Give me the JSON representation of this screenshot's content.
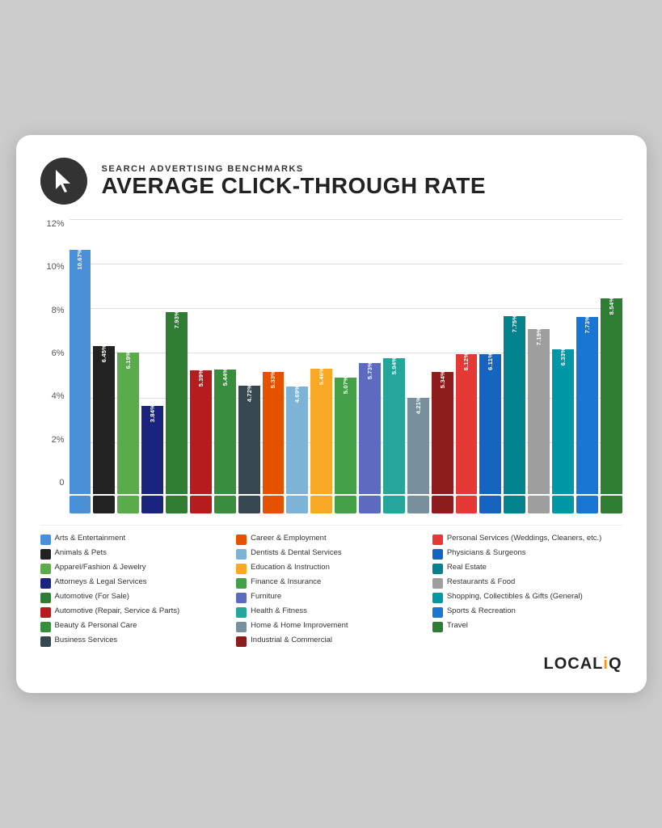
{
  "header": {
    "subtitle": "Search Advertising Benchmarks",
    "title": "Average Click-Through Rate",
    "icon_label": "cursor-icon"
  },
  "chart": {
    "y_labels": [
      "12%",
      "10%",
      "8%",
      "6%",
      "4%",
      "2%",
      "0"
    ],
    "max_value": 12,
    "bars": [
      {
        "label": "Arts & Entertainment",
        "value": 10.67,
        "color": "#4a90d9",
        "icon": "🎭"
      },
      {
        "label": "Animals & Pets",
        "value": 6.45,
        "color": "#222",
        "icon": "🐾"
      },
      {
        "label": "Apparel/Fashion & Jewelry",
        "value": 6.19,
        "color": "#5aab4a",
        "icon": "👗"
      },
      {
        "label": "Attorneys & Legal Services",
        "value": 3.84,
        "color": "#1a237e",
        "icon": "⚖️"
      },
      {
        "label": "Automotive (For Sale)",
        "value": 7.93,
        "color": "#2e7d32",
        "icon": "🚗"
      },
      {
        "label": "Automotive (Repair, Service & Parts)",
        "value": 5.39,
        "color": "#b71c1c",
        "icon": "🔧"
      },
      {
        "label": "Beauty & Personal Care",
        "value": 5.44,
        "color": "#388e3c",
        "icon": "💄"
      },
      {
        "label": "Business Services",
        "value": 4.72,
        "color": "#37474f",
        "icon": "💼"
      },
      {
        "label": "Career & Employment",
        "value": 5.33,
        "color": "#e65100",
        "icon": "💼"
      },
      {
        "label": "Dentists & Dental Services",
        "value": 4.69,
        "color": "#7eb3d8",
        "icon": "🦷"
      },
      {
        "label": "Education & Instruction",
        "value": 5.46,
        "color": "#f9a825",
        "icon": "📚"
      },
      {
        "label": "Finance & Insurance",
        "value": 5.07,
        "color": "#43a047",
        "icon": "💰"
      },
      {
        "label": "Furniture",
        "value": 5.73,
        "color": "#5c6bc0",
        "icon": "🛋️"
      },
      {
        "label": "Health & Fitness",
        "value": 5.94,
        "color": "#26a69a",
        "icon": "🏋️"
      },
      {
        "label": "Home & Home Improvement",
        "value": 4.21,
        "color": "#78909c",
        "icon": "🏠"
      },
      {
        "label": "Industrial & Commercial",
        "value": 5.34,
        "color": "#8d1c1c",
        "icon": "🏭"
      },
      {
        "label": "Personal Services",
        "value": 6.12,
        "color": "#e53935",
        "icon": "✂️"
      },
      {
        "label": "Physicians & Surgeons",
        "value": 6.11,
        "color": "#1565c0",
        "icon": "⚕️"
      },
      {
        "label": "Real Estate",
        "value": 7.75,
        "color": "#00838f",
        "icon": "🏡"
      },
      {
        "label": "Restaurants & Food",
        "value": 7.19,
        "color": "#9e9e9e",
        "icon": "🍽️"
      },
      {
        "label": "Shopping, Collectibles & Gifts",
        "value": 6.33,
        "color": "#0097a7",
        "icon": "🛍️"
      },
      {
        "label": "Sports & Recreation",
        "value": 7.73,
        "color": "#1976d2",
        "icon": "⚽"
      },
      {
        "label": "Travel",
        "value": 8.54,
        "color": "#2e7d32",
        "icon": "✈️"
      }
    ]
  },
  "legend": {
    "items": [
      {
        "label": "Arts & Entertainment",
        "color": "#4a90d9"
      },
      {
        "label": "Career & Employment",
        "color": "#e65100"
      },
      {
        "label": "Personal Services (Weddings, Cleaners, etc.)",
        "color": "#e53935"
      },
      {
        "label": "Animals & Pets",
        "color": "#222"
      },
      {
        "label": "Dentists & Dental Services",
        "color": "#7eb3d8"
      },
      {
        "label": "Physicians & Surgeons",
        "color": "#1565c0"
      },
      {
        "label": "Apparel/Fashion & Jewelry",
        "color": "#5aab4a"
      },
      {
        "label": "Education & Instruction",
        "color": "#f9a825"
      },
      {
        "label": "Real Estate",
        "color": "#00838f"
      },
      {
        "label": "Attorneys & Legal Services",
        "color": "#1a237e"
      },
      {
        "label": "Finance & Insurance",
        "color": "#43a047"
      },
      {
        "label": "Restaurants & Food",
        "color": "#9e9e9e"
      },
      {
        "label": "Automotive (For Sale)",
        "color": "#2e7d32"
      },
      {
        "label": "Furniture",
        "color": "#5c6bc0"
      },
      {
        "label": "Shopping, Collectibles & Gifts (General)",
        "color": "#0097a7"
      },
      {
        "label": "Automotive (Repair, Service & Parts)",
        "color": "#b71c1c"
      },
      {
        "label": "Health & Fitness",
        "color": "#26a69a"
      },
      {
        "label": "Sports & Recreation",
        "color": "#1976d2"
      },
      {
        "label": "Beauty & Personal Care",
        "color": "#388e3c"
      },
      {
        "label": "Home & Home Improvement",
        "color": "#78909c"
      },
      {
        "label": "Travel",
        "color": "#2e7d32"
      },
      {
        "label": "Business Services",
        "color": "#37474f"
      },
      {
        "label": "Industrial & Commercial",
        "color": "#8d1c1c"
      }
    ]
  },
  "footer": {
    "logo": "LOCALiQ"
  }
}
